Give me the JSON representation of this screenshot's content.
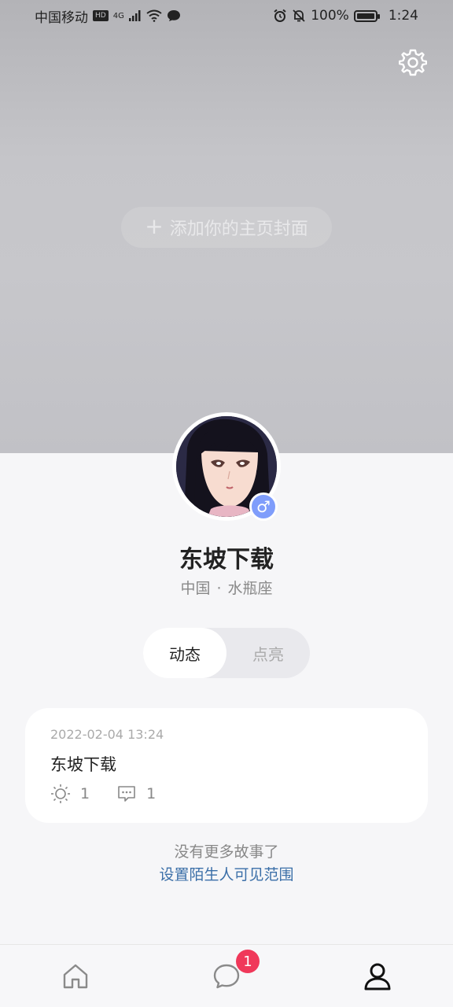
{
  "status_bar": {
    "carrier": "中国移动",
    "hd": "HD",
    "network": "4G",
    "battery": "100%",
    "time": "1:24"
  },
  "cover": {
    "add_cover_label": "添加你的主页封面"
  },
  "profile": {
    "name": "东坡下载",
    "location": "中国",
    "separator": "·",
    "zodiac": "水瓶座",
    "gender_symbol": "♂",
    "gender_color": "#7f9dfb"
  },
  "tabs": [
    {
      "label": "动态",
      "active": true
    },
    {
      "label": "点亮",
      "active": false
    }
  ],
  "posts": [
    {
      "time": "2022-02-04 13:24",
      "content": "东坡下载",
      "likes": "1",
      "comments": "1"
    }
  ],
  "footer": {
    "no_more": "没有更多故事了",
    "visibility_link": "设置陌生人可见范围"
  },
  "bottom_nav": {
    "message_badge": "1",
    "items": [
      "home-icon",
      "chat-icon",
      "profile-icon"
    ]
  },
  "colors": {
    "accent_link": "#3b6fa8",
    "badge": "#f0385a"
  }
}
